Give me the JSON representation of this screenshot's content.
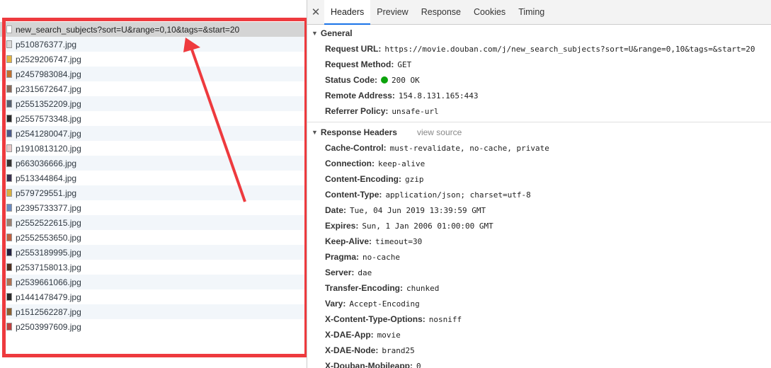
{
  "network": {
    "requests": [
      {
        "name": "new_search_subjects?sort=U&range=0,10&tags=&start=20",
        "icon": "document-icon",
        "selected": true
      },
      {
        "name": "p510876377.jpg",
        "icon": "image-thumb-icon",
        "color": "#d8d8d8"
      },
      {
        "name": "p2529206747.jpg",
        "icon": "image-thumb-icon",
        "color": "#e3b342"
      },
      {
        "name": "p2457983084.jpg",
        "icon": "image-thumb-icon",
        "color": "#c07030"
      },
      {
        "name": "p2315672647.jpg",
        "icon": "image-thumb-icon",
        "color": "#8a6a5a"
      },
      {
        "name": "p2551352209.jpg",
        "icon": "image-thumb-icon",
        "color": "#556070"
      },
      {
        "name": "p2557573348.jpg",
        "icon": "image-thumb-icon",
        "color": "#2a2a2a"
      },
      {
        "name": "p2541280047.jpg",
        "icon": "image-thumb-icon",
        "color": "#4a5a8a"
      },
      {
        "name": "p1910813120.jpg",
        "icon": "image-thumb-icon",
        "color": "#e8c8c8"
      },
      {
        "name": "p663036666.jpg",
        "icon": "image-thumb-icon",
        "color": "#333333"
      },
      {
        "name": "p513344864.jpg",
        "icon": "image-thumb-icon",
        "color": "#3a3050"
      },
      {
        "name": "p579729551.jpg",
        "icon": "image-thumb-icon",
        "color": "#d8b040"
      },
      {
        "name": "p2395733377.jpg",
        "icon": "image-thumb-icon",
        "color": "#6a8ac0"
      },
      {
        "name": "p2552522615.jpg",
        "icon": "image-thumb-icon",
        "color": "#9a8070"
      },
      {
        "name": "p2552553650.jpg",
        "icon": "image-thumb-icon",
        "color": "#c06040"
      },
      {
        "name": "p2553189995.jpg",
        "icon": "image-thumb-icon",
        "color": "#202040"
      },
      {
        "name": "p2537158013.jpg",
        "icon": "image-thumb-icon",
        "color": "#503020"
      },
      {
        "name": "p2539661066.jpg",
        "icon": "image-thumb-icon",
        "color": "#b07050"
      },
      {
        "name": "p1441478479.jpg",
        "icon": "image-thumb-icon",
        "color": "#2a2a2a"
      },
      {
        "name": "p1512562287.jpg",
        "icon": "image-thumb-icon",
        "color": "#8a6030"
      },
      {
        "name": "p2503997609.jpg",
        "icon": "image-thumb-icon",
        "color": "#c04040"
      }
    ],
    "annotation_color": "#ee3a3e"
  },
  "details": {
    "tabs": [
      "Headers",
      "Preview",
      "Response",
      "Cookies",
      "Timing"
    ],
    "active_tab": "Headers",
    "general": {
      "title": "General",
      "rows": [
        {
          "key": "Request URL:",
          "value": "https://movie.douban.com/j/new_search_subjects?sort=U&range=0,10&tags=&start=20"
        },
        {
          "key": "Request Method:",
          "value": "GET"
        },
        {
          "key": "Status Code:",
          "value": "200 OK",
          "status_dot": "#0ca30c"
        },
        {
          "key": "Remote Address:",
          "value": "154.8.131.165:443"
        },
        {
          "key": "Referrer Policy:",
          "value": "unsafe-url"
        }
      ]
    },
    "response_headers": {
      "title": "Response Headers",
      "view_source": "view source",
      "rows": [
        {
          "key": "Cache-Control:",
          "value": "must-revalidate, no-cache, private"
        },
        {
          "key": "Connection:",
          "value": "keep-alive"
        },
        {
          "key": "Content-Encoding:",
          "value": "gzip"
        },
        {
          "key": "Content-Type:",
          "value": "application/json; charset=utf-8"
        },
        {
          "key": "Date:",
          "value": "Tue, 04 Jun 2019 13:39:59 GMT"
        },
        {
          "key": "Expires:",
          "value": "Sun, 1 Jan 2006 01:00:00 GMT"
        },
        {
          "key": "Keep-Alive:",
          "value": "timeout=30"
        },
        {
          "key": "Pragma:",
          "value": "no-cache"
        },
        {
          "key": "Server:",
          "value": "dae"
        },
        {
          "key": "Transfer-Encoding:",
          "value": "chunked"
        },
        {
          "key": "Vary:",
          "value": "Accept-Encoding"
        },
        {
          "key": "X-Content-Type-Options:",
          "value": "nosniff"
        },
        {
          "key": "X-DAE-App:",
          "value": "movie"
        },
        {
          "key": "X-DAE-Node:",
          "value": "brand25"
        },
        {
          "key": "X-Douban-Mobileapp:",
          "value": "0"
        }
      ]
    }
  }
}
